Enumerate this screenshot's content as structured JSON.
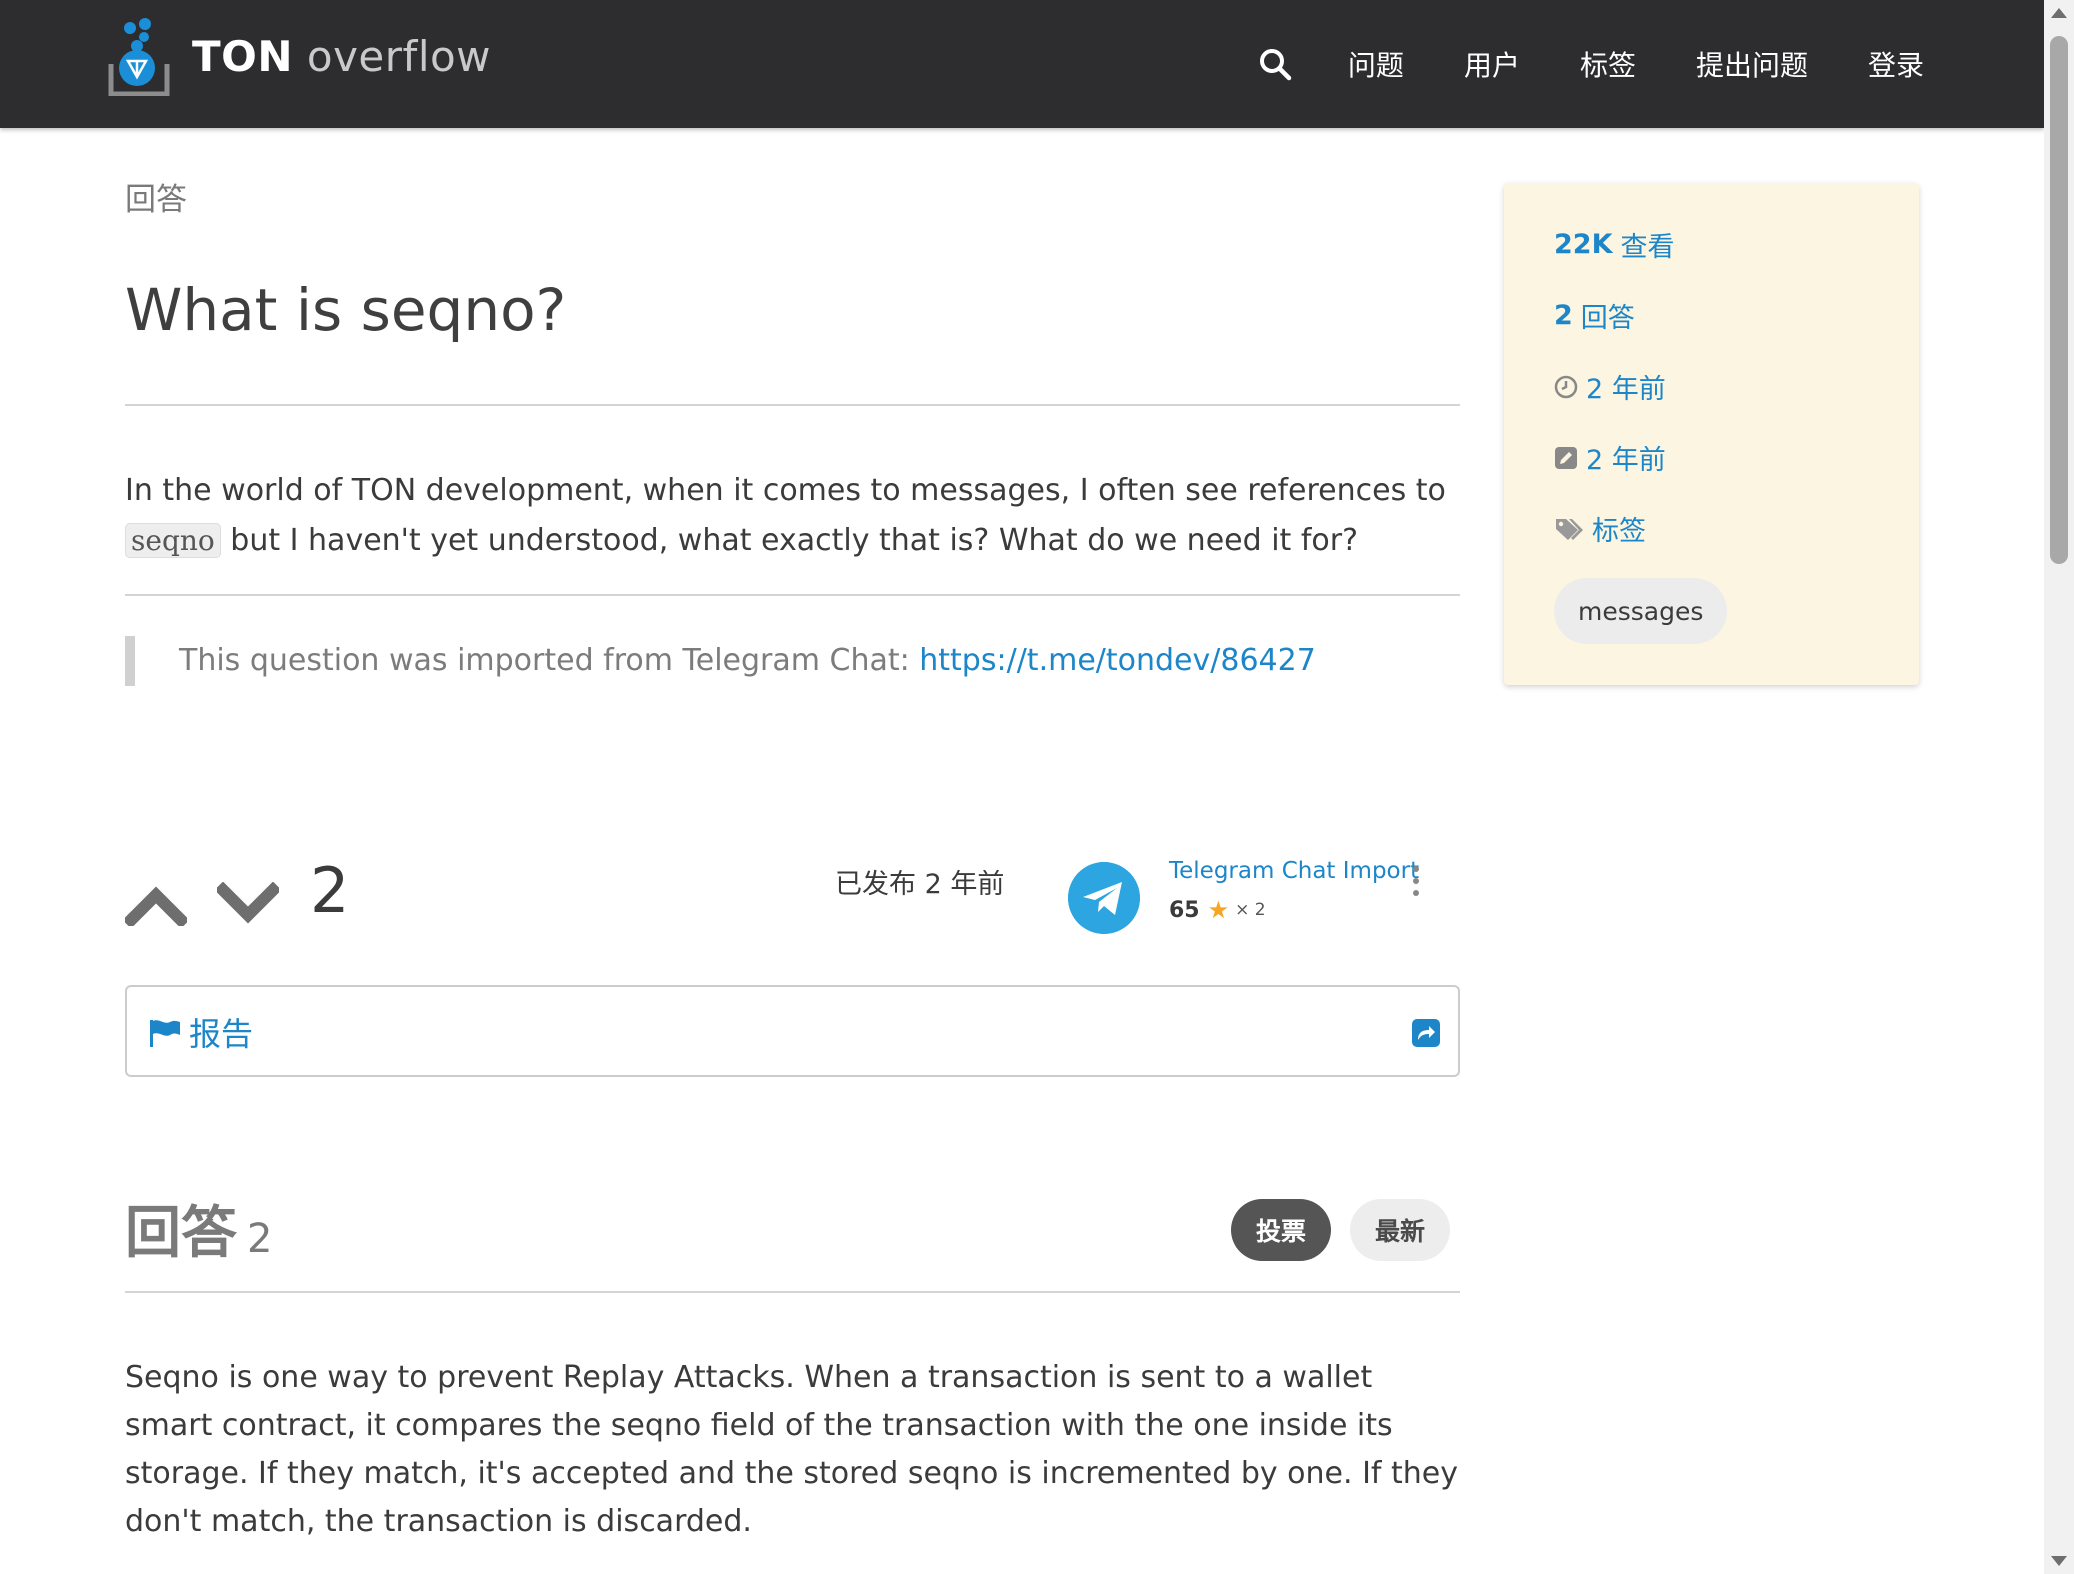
{
  "header": {
    "logo_bold": "TON",
    "logo_light": "overflow",
    "nav": [
      "问题",
      "用户",
      "标签",
      "提出问题",
      "登录"
    ]
  },
  "main": {
    "breadcrumb": "回答",
    "question_title": "What is seqno?",
    "body_before_code": "In the world of TON development, when it comes to messages, I often see references to ",
    "body_code": "seqno",
    "body_after_code": " but I haven't yet understood, what exactly that is? What do we need it for?",
    "quote_text": "This question was imported from Telegram Chat: ",
    "quote_link": "https://t.me/tondev/86427",
    "vote_count": "2",
    "posted_label": "已发布 2 年前",
    "author_name": "Telegram Chat Import",
    "author_rep": "65",
    "author_badge_mult": "× 2",
    "report_label": "报告",
    "answers_label": "回答",
    "answers_count": "2",
    "sort_votes": "投票",
    "sort_newest": "最新",
    "answer_text": "Seqno is one way to prevent Replay Attacks. When a transaction is sent to a wallet smart contract, it compares the seqno field of the transaction with the one inside its storage. If they match, it's accepted and the stored seqno is incremented by one. If they don't match, the transaction is discarded."
  },
  "sidebar": {
    "views_num": "22K",
    "views_label": "查看",
    "answers_num": "2",
    "answers_label": "回答",
    "asked": "2 年前",
    "edited": "2 年前",
    "tags_label": "标签",
    "tags": [
      "messages"
    ]
  },
  "colors": {
    "header_bg": "#2d2d30",
    "link": "#1c86c9",
    "sidebar_bg": "#fbf5e2",
    "telegram": "#2ca5e0",
    "star": "#f5a623"
  }
}
